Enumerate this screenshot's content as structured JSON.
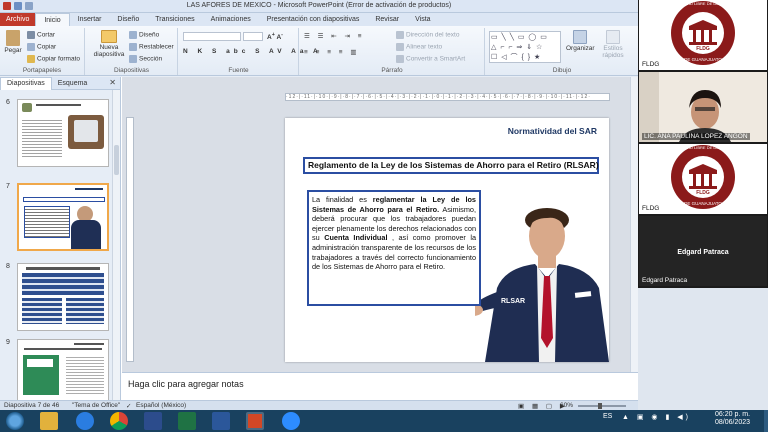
{
  "window": {
    "title": "LAS AFORES DE MEXICO - Microsoft PowerPoint (Error de activación de productos)"
  },
  "ribbon_tabs": [
    "Archivo",
    "Inicio",
    "Insertar",
    "Diseño",
    "Transiciones",
    "Animaciones",
    "Presentación con diapositivas",
    "Revisar",
    "Vista"
  ],
  "ribbon": {
    "paste": "Pegar",
    "cut": "Cortar",
    "copy": "Copiar",
    "format_painter": "Copiar formato",
    "new_slide_1": "Nueva",
    "new_slide_2": "diapositiva",
    "design": "Diseño",
    "reset": "Restablecer",
    "section": "Sección",
    "text_direction": "Dirección del texto",
    "align_text": "Alinear texto",
    "smartart": "Convertir a SmartArt",
    "organize": "Organizar",
    "quick_styles_1": "Estilos",
    "quick_styles_2": "rápidos",
    "groups": {
      "clipboard": "Portapapeles",
      "slides": "Diapositivas",
      "font": "Fuente",
      "paragraph": "Párrafo",
      "drawing": "Dibujo"
    }
  },
  "panel": {
    "tabs": [
      "Diapositivas",
      "Esquema"
    ],
    "slide_numbers": [
      "6",
      "7",
      "8",
      "9"
    ]
  },
  "slide": {
    "header": "Normatividad del SAR",
    "title": "Reglamento de la Ley de los Sistemas de Ahorro para el Retiro (RLSAR)",
    "body_lead": "La finalidad es ",
    "body_bold": "reglamentar la Ley de los Sistemas de Ahorro para el Retiro.",
    "body_mid": " Asimismo, deberá procurar que los trabajadores puedan ejercer plenamente los derechos relacionados con su ",
    "body_bold2": "Cuenta Individual",
    "body_end": " , así como promover la administración transparente de los recursos de los trabajadores a través del correcto funcionamiento de los Sistemas de Ahorro para el Retiro.",
    "sign_text": "RLSAR"
  },
  "notes_placeholder": "Haga clic para agregar notas",
  "status": {
    "slide_info": "Diapositiva 7 de 46",
    "theme": "\"Tema de Office\"",
    "language": "Español (México)",
    "zoom": "60%"
  },
  "participants": [
    {
      "name": "FLDG",
      "type": "logo"
    },
    {
      "name": "LIC. ANA PAULINA LOPEZ ANGON",
      "type": "camera"
    },
    {
      "name": "FLDG",
      "type": "logo"
    },
    {
      "name": "Edgard Patraca",
      "type": "initials",
      "center_name": "Edgard Patraca"
    }
  ],
  "logo_text": {
    "top": "FACULTAD LIBRE DE DERECHO",
    "bottom": "DE GUANAJUATO",
    "center": "FLDG"
  },
  "taskbar": {
    "lang": "ES",
    "time": "06:20 p. m.",
    "date": "08/06/2023"
  },
  "colors": {
    "accent_file_tab": "#c0392b",
    "slide_border": "#2b4ea2",
    "slide_header": "#1f3864",
    "logo_red": "#8b1a1a"
  }
}
